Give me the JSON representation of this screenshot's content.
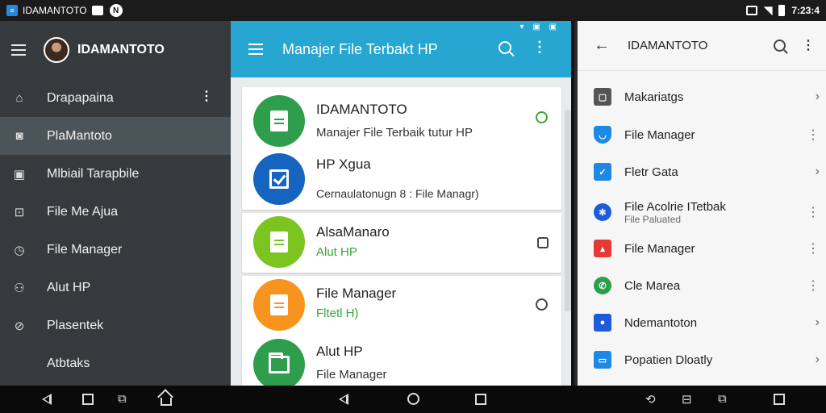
{
  "status_bar": {
    "app_name": "IDAMANTOTO",
    "n_badge": "N",
    "time": "7:23:4"
  },
  "drawer": {
    "title": "IDAMANTOTO",
    "items": [
      {
        "label": "Drapapaina",
        "icon": "home-icon"
      },
      {
        "label": "PlaMantoto",
        "icon": "camera-icon",
        "active": true
      },
      {
        "label": "Mlbiail Tarapbile",
        "icon": "display-icon"
      },
      {
        "label": "File Me Ajua",
        "icon": "file-icon"
      },
      {
        "label": "File Manager",
        "icon": "clock-icon"
      },
      {
        "label": "Alut HP",
        "icon": "people-icon"
      },
      {
        "label": "Plasentek",
        "icon": "compass-icon"
      },
      {
        "label": "Atbtaks",
        "icon": ""
      }
    ]
  },
  "center": {
    "title": "Manajer File Terbakt HP",
    "cards": [
      {
        "title": "IDAMANTOTO",
        "subtitle": "Manajer File Terbaik tutur HP",
        "color": "#2e9e4d"
      },
      {
        "title": "HP Xgua",
        "subtitle": "Cernaulatonugn 8 : File Managr)",
        "color": "#1565c0"
      },
      {
        "title": "AlsaManaro",
        "subtitle": "Alut HP",
        "color": "#7cc520"
      },
      {
        "title": "File Manager",
        "subtitle": "Fltetl H)",
        "color": "#f7941d"
      },
      {
        "title": "Alut HP",
        "subtitle": "File Manager",
        "color": "#2e9e4d"
      }
    ]
  },
  "right_panel": {
    "title": "IDAMANTOTO",
    "items": [
      {
        "label": "Makariatgs",
        "icon_color": "#555555",
        "trail": "chevron"
      },
      {
        "label": "File Manager",
        "icon_color": "#1e88e5",
        "trail": "more"
      },
      {
        "label": "Fletr Gata",
        "icon_color": "#1e88e5",
        "trail": "chevron"
      },
      {
        "label": "File Acolrie ITetbak",
        "sub": "File Paluated",
        "icon_color": "#1e5bd8",
        "trail": "more"
      },
      {
        "label": "File Manager",
        "icon_color": "#e53935",
        "trail": "more"
      },
      {
        "label": "Cle Marea",
        "icon_color": "#2e9e4d",
        "trail": "more"
      },
      {
        "label": "Ndemantoton",
        "icon_color": "#1e5bd8",
        "trail": "chevron"
      },
      {
        "label": "Popatien Dloatly",
        "icon_color": "#1e88e5",
        "trail": "chevron"
      }
    ]
  }
}
